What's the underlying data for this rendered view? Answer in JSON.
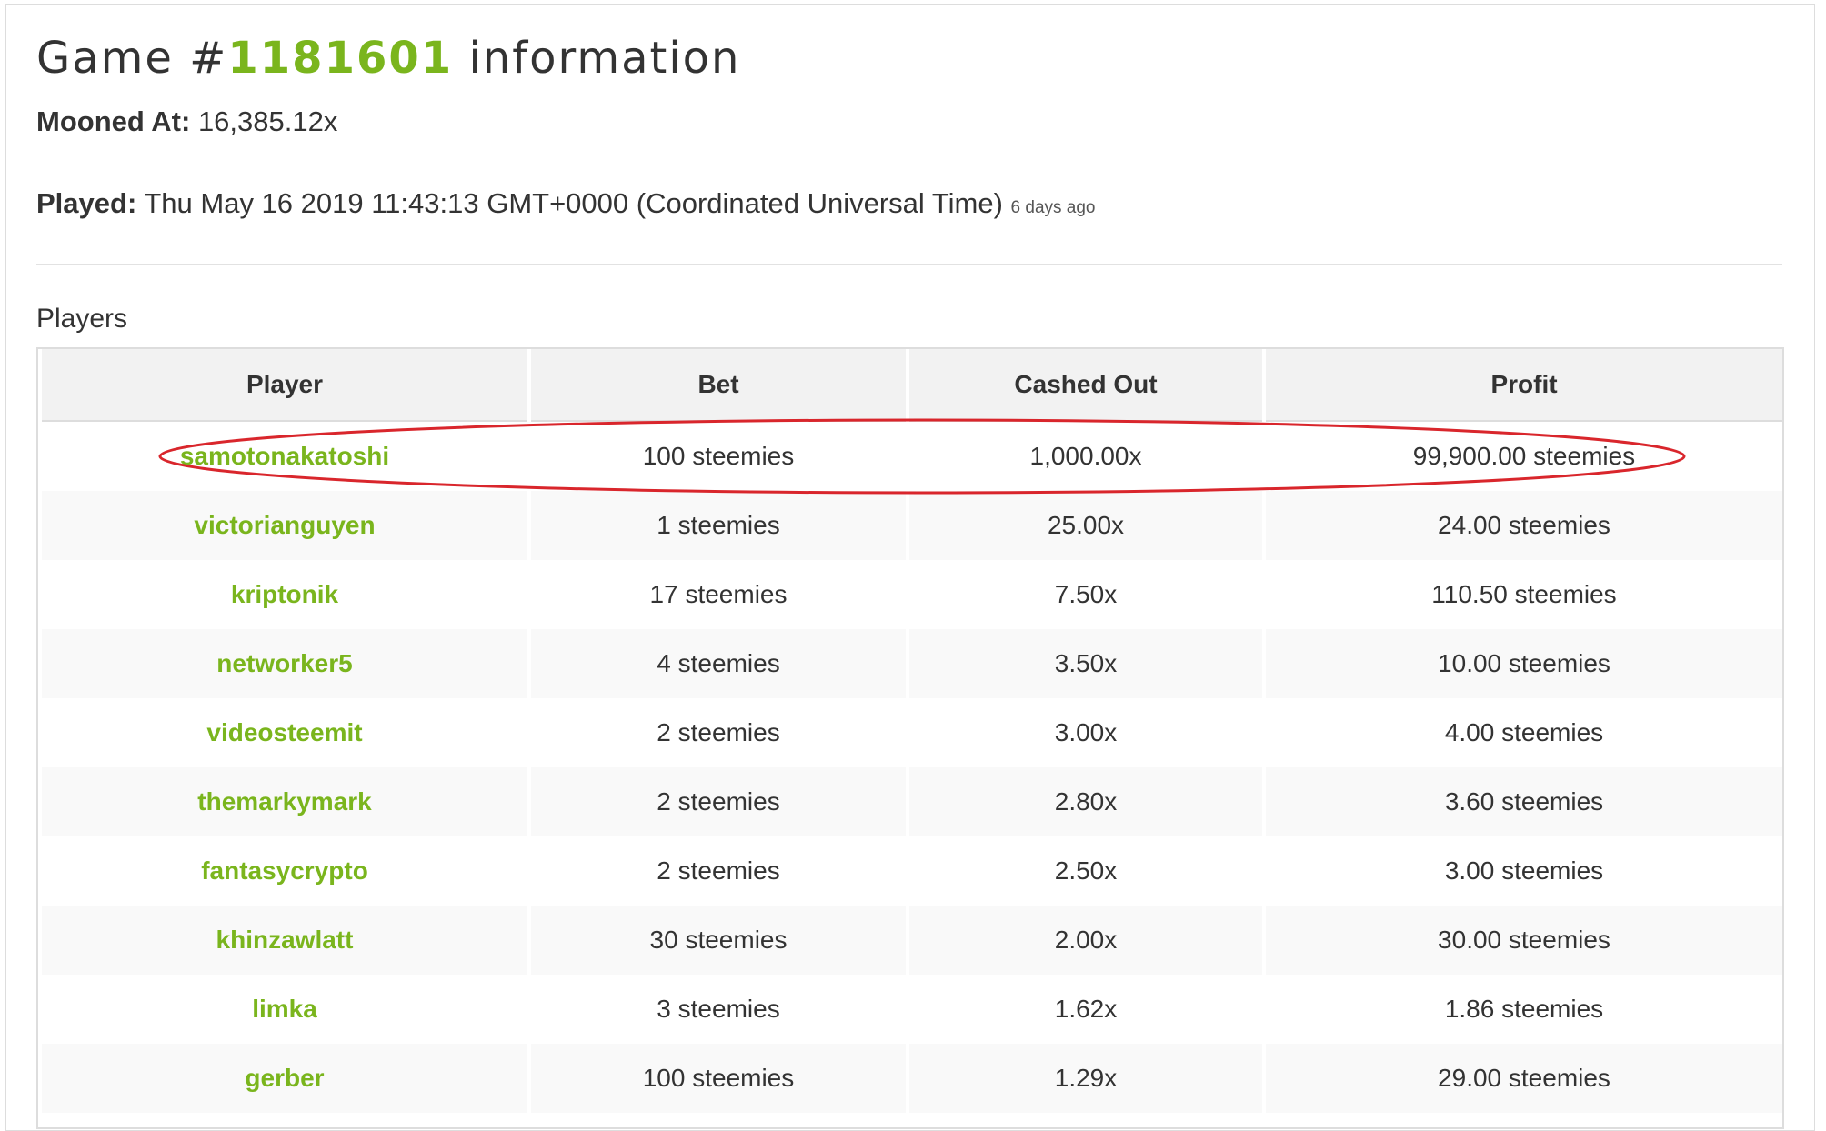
{
  "header": {
    "title_prefix": "Game #",
    "game_id": "1181601",
    "title_suffix": "information"
  },
  "mooned": {
    "label": "Mooned At:",
    "value": "16,385.12x"
  },
  "played": {
    "label": "Played:",
    "value": "Thu May 16 2019 11:43:13 GMT+0000 (Coordinated Universal Time)",
    "relative": "6 days ago"
  },
  "players_section": {
    "title": "Players",
    "columns": [
      "Player",
      "Bet",
      "Cashed Out",
      "Profit"
    ],
    "rows": [
      {
        "player": "samotonakatoshi",
        "bet": "100 steemies",
        "cashed_out": "1,000.00x",
        "profit": "99,900.00 steemies"
      },
      {
        "player": "victorianguyen",
        "bet": "1 steemies",
        "cashed_out": "25.00x",
        "profit": "24.00 steemies"
      },
      {
        "player": "kriptonik",
        "bet": "17 steemies",
        "cashed_out": "7.50x",
        "profit": "110.50 steemies"
      },
      {
        "player": "networker5",
        "bet": "4 steemies",
        "cashed_out": "3.50x",
        "profit": "10.00 steemies"
      },
      {
        "player": "videosteemit",
        "bet": "2 steemies",
        "cashed_out": "3.00x",
        "profit": "4.00 steemies"
      },
      {
        "player": "themarkymark",
        "bet": "2 steemies",
        "cashed_out": "2.80x",
        "profit": "3.60 steemies"
      },
      {
        "player": "fantasycrypto",
        "bet": "2 steemies",
        "cashed_out": "2.50x",
        "profit": "3.00 steemies"
      },
      {
        "player": "khinzawlatt",
        "bet": "30 steemies",
        "cashed_out": "2.00x",
        "profit": "30.00 steemies"
      },
      {
        "player": "limka",
        "bet": "3 steemies",
        "cashed_out": "1.62x",
        "profit": "1.86 steemies"
      },
      {
        "player": "gerber",
        "bet": "100 steemies",
        "cashed_out": "1.29x",
        "profit": "29.00 steemies"
      }
    ]
  },
  "colors": {
    "accent_green": "#7ab51d",
    "annotation_red": "#d9262c",
    "row_stripe": "#f9f9f9",
    "header_bg": "#f2f2f2"
  }
}
